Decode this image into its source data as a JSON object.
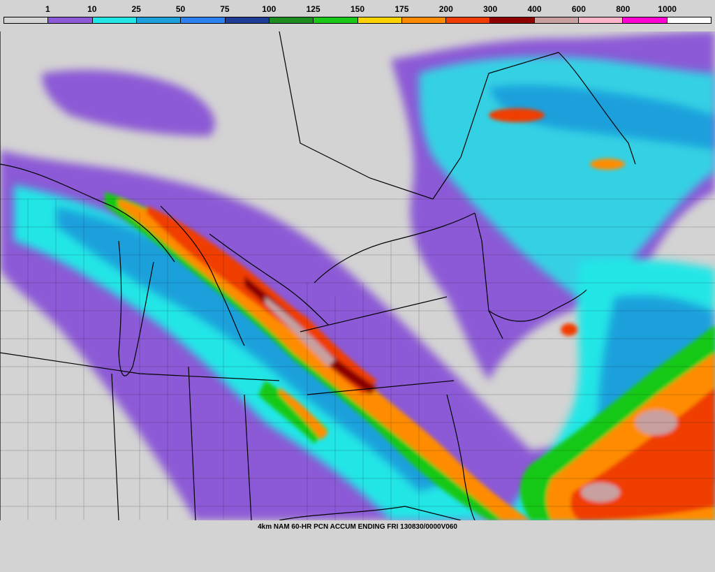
{
  "legend": {
    "labels": [
      "1",
      "10",
      "25",
      "50",
      "75",
      "100",
      "125",
      "150",
      "175",
      "200",
      "300",
      "400",
      "600",
      "800",
      "1000"
    ],
    "colors": [
      "#d3d3d3",
      "#8c5ad6",
      "#23e6e6",
      "#1ea0dc",
      "#2d82f0",
      "#1e3c96",
      "#1e8c1e",
      "#19c819",
      "#ffd200",
      "#ff8c00",
      "#f03c00",
      "#8c0000",
      "#c8a0a0",
      "#ffb4c8",
      "#ff00d2",
      "#ffffff"
    ]
  },
  "caption": "4km NAM 60-HR PCN ACCUM ENDING FRI 130830/0000V060",
  "map": {
    "background": "#d3d3d3",
    "border_color": "#000000"
  }
}
